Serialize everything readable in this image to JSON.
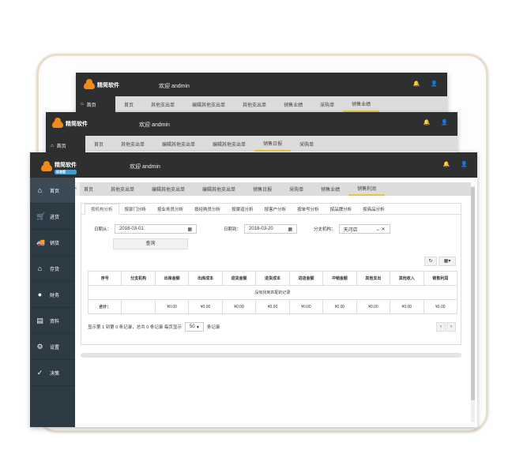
{
  "brand": {
    "name": "精简软件",
    "sub": "标准版"
  },
  "welcome": "欢迎 andmin",
  "back_tabs_1": [
    "首页",
    "其他支出单",
    "编辑其他支出单",
    "其他支出单",
    "销售业绩",
    "采购单",
    "销售业绩"
  ],
  "back_tabs_2": [
    "首页",
    "其他支出单",
    "编辑其他支出单",
    "编辑其他支出单",
    "销售日报",
    "采购单"
  ],
  "home_label": "首页",
  "tabs": [
    "首页",
    "其他支出单",
    "编辑其他支出单",
    "编辑其他支出单",
    "销售日报",
    "采购单",
    "销售业绩",
    "销售利润"
  ],
  "sidebar": [
    "首页",
    "进货",
    "销货",
    "存货",
    "财务",
    "资料",
    "设置",
    "决策"
  ],
  "subtabs": [
    "按机构分析",
    "按部门分析",
    "按业务员分析",
    "按经购员分析",
    "按渠道分析",
    "按客户分析",
    "按单号分析",
    "按品牌分析",
    "按商品分析"
  ],
  "filters": {
    "date_from_label": "日期从：",
    "date_from": "2018-03-01",
    "date_to_label": "日期到：",
    "date_to": "2018-03-20",
    "branch_label": "分支机构：",
    "branch": "天河店",
    "query": "查询"
  },
  "table": {
    "headers": [
      "序号",
      "分支机构",
      "出库金额",
      "出库成本",
      "退货金额",
      "退货成本",
      "进店金额",
      "冲销金额",
      "其他支出",
      "其他收入",
      "销售利润"
    ],
    "empty": "没有找到匹配的记录",
    "total_label": "合计：",
    "totals": [
      "",
      "¥0.00",
      "¥0.00",
      "¥0.00",
      "¥0.00",
      "¥0.00",
      "¥0.00",
      "¥0.00",
      "¥0.00",
      "¥0.00"
    ]
  },
  "pager": {
    "prefix": "显示第 1 到第 0 条记录，总共 0 条记录 每页显示",
    "size": "50",
    "suffix": "条记录",
    "prev": "‹",
    "next": "›"
  },
  "colors": {
    "topbar": "#2e2f31",
    "sidebar": "#2d3b45",
    "tabbar": "#dcdcdc",
    "accent": "#e7c542",
    "logo": "#f08a1c"
  }
}
